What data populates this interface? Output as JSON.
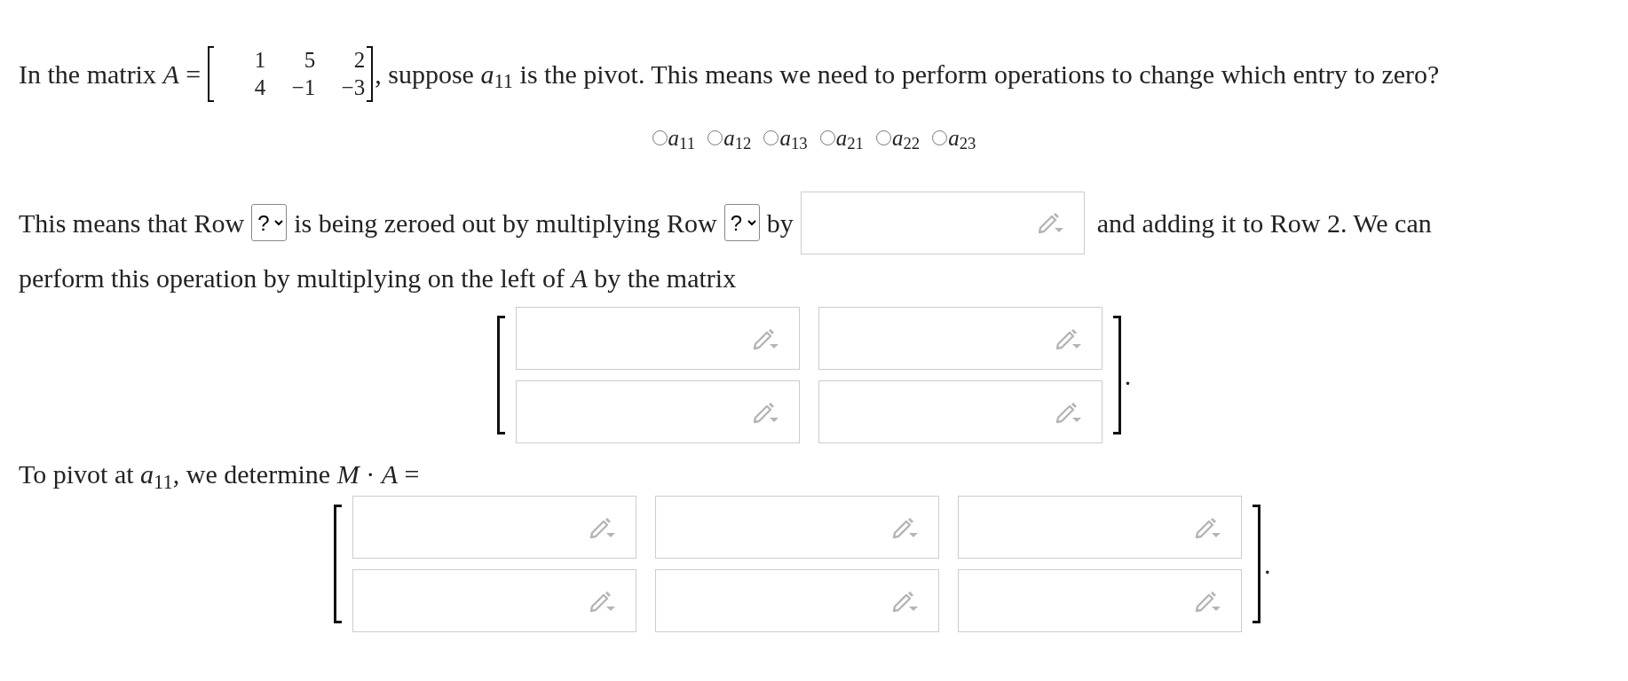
{
  "question": {
    "text_before": "In the matrix *A* =",
    "matrix": [
      [
        "1",
        "5",
        "2"
      ],
      [
        "4",
        "−1",
        "−3"
      ]
    ],
    "text_after": ", suppose *a*$_{11}$ is the pivot. This means we need to perform operations to change which entry to zero?"
  },
  "choices": [
    {
      "label": "*a*$_{11}$",
      "selected": false
    },
    {
      "label": "*a*$_{12}$",
      "selected": false
    },
    {
      "label": "*a*$_{13}$",
      "selected": false
    },
    {
      "label": "*a*$_{21}$",
      "selected": false
    },
    {
      "label": "*a*$_{22}$",
      "selected": false
    },
    {
      "label": "*a*$_{23}$",
      "selected": false
    }
  ],
  "step": {
    "lines": [
      [
        {
          "kind": "text",
          "text": "This means that Row"
        },
        {
          "kind": "select",
          "value": "?"
        },
        {
          "kind": "text",
          "text": "is being zeroed out by multiplying Row"
        },
        {
          "kind": "select",
          "value": "?"
        },
        {
          "kind": "text",
          "text": "by"
        },
        {
          "kind": "input"
        },
        {
          "kind": "text",
          "text": "and adding it to Row 2. We can"
        }
      ],
      [
        {
          "kind": "text",
          "text": "perform this operation by multiplying on the left of *A* by the matrix"
        }
      ]
    ],
    "matrix": [
      [
        {
          "kind": "input"
        },
        {
          "kind": "input"
        }
      ],
      [
        {
          "kind": "input"
        },
        {
          "kind": "input"
        }
      ]
    ],
    "end": "."
  },
  "pivot": {
    "text": "To pivot at *a*$_{11}$, we determine *M* · *A* =",
    "matrix": [
      [
        {
          "kind": "input"
        },
        {
          "kind": "input"
        },
        {
          "kind": "input"
        }
      ],
      [
        {
          "kind": "input"
        },
        {
          "kind": "input"
        },
        {
          "kind": "input"
        }
      ]
    ],
    "end": "."
  }
}
